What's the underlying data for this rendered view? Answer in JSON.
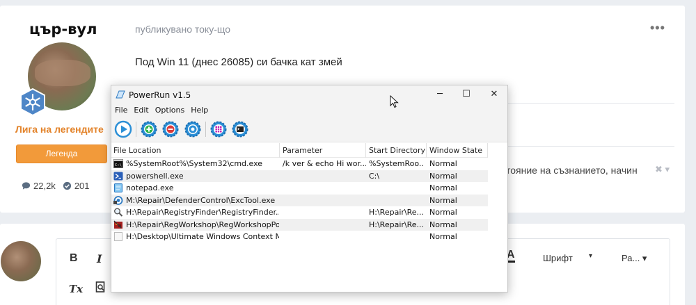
{
  "post": {
    "username": "цър-вул",
    "rank": "Лига на легендите",
    "rank_button": "Легенда",
    "stats": {
      "posts": "22,2k",
      "reputation": "201"
    },
    "posted": "публикувано току-що",
    "more": "•••",
    "content": "Под Win 11 (днес 26085) си бачка кат змей",
    "signature": "стояние на съзнанието, начин",
    "signature_icons": "✖ ▾"
  },
  "editor": {
    "bold": "B",
    "italic": "I",
    "clear": "Tx",
    "color": "A",
    "font": "Шрифт",
    "font_caret": "▾",
    "size": "Ра... ▾"
  },
  "window": {
    "title": "PowerRun v1.5",
    "minimize": "─",
    "maximize": "☐",
    "close": "✕",
    "menu": [
      "File",
      "Edit",
      "Options",
      "Help"
    ],
    "columns": [
      "File Location",
      "Parameter",
      "Start Directory",
      "Window State"
    ],
    "rows": [
      {
        "icon": "cmd-icon",
        "file": "%SystemRoot%\\System32\\cmd.exe",
        "param": "/k ver & echo Hi wor...",
        "dir": "%SystemRoo...",
        "state": "Normal"
      },
      {
        "icon": "powershell-icon",
        "file": "powershell.exe",
        "param": "",
        "dir": "C:\\",
        "state": "Normal"
      },
      {
        "icon": "notepad-icon",
        "file": "notepad.exe",
        "param": "",
        "dir": "",
        "state": "Normal"
      },
      {
        "icon": "defender-icon",
        "file": "M:\\Repair\\DefenderControl\\ExcTool.exe",
        "param": "",
        "dir": "",
        "state": "Normal"
      },
      {
        "icon": "magnifier-icon",
        "file": "H:\\Repair\\RegistryFinder\\RegistryFinder....",
        "param": "",
        "dir": "H:\\Repair\\Re...",
        "state": "Normal"
      },
      {
        "icon": "regworkshop-icon",
        "file": "H:\\Repair\\RegWorkshop\\RegWorkshopPo...",
        "param": "",
        "dir": "H:\\Repair\\Re...",
        "state": "Normal"
      },
      {
        "icon": "blank-file-icon",
        "file": "H:\\Desktop\\Ultimate Windows Context M...",
        "param": "",
        "dir": "",
        "state": "Normal"
      }
    ]
  },
  "colors": {
    "rank": "#e3832a",
    "rank_button": "#f29a3a",
    "toolbar_blue": "#2b8fd6",
    "toolbar_green": "#2fb34a",
    "toolbar_red": "#d93a3a",
    "toolbar_magenta": "#c42bb5"
  }
}
